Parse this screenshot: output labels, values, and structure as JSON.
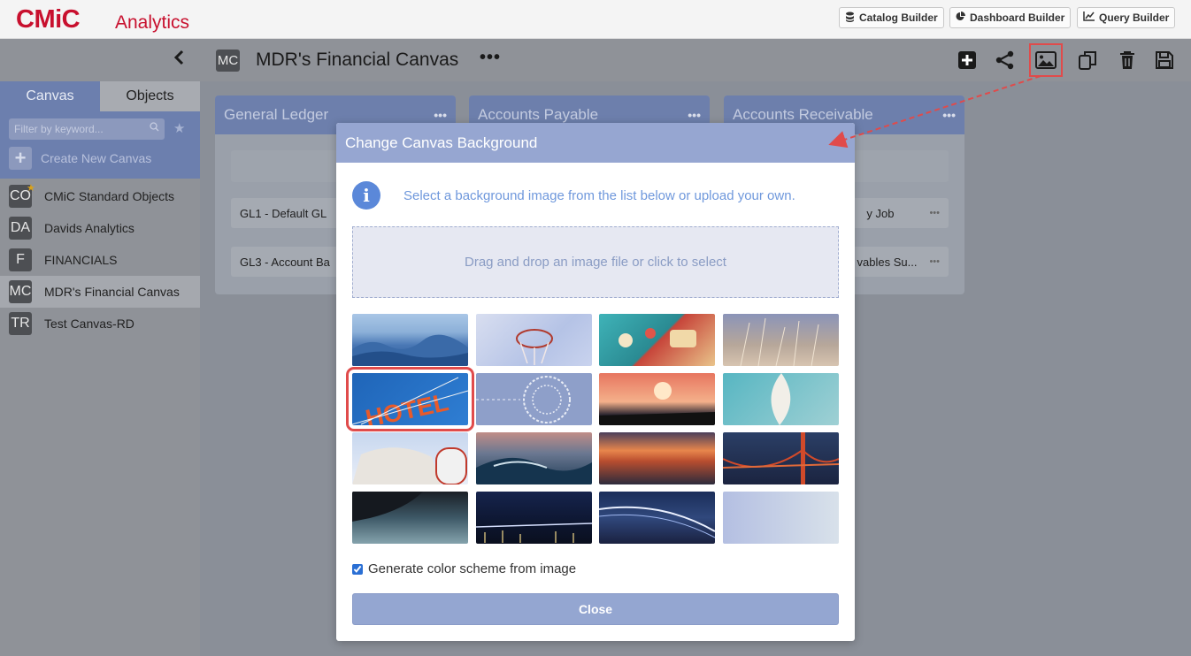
{
  "app": {
    "logo": "CMiC",
    "product": "Analytics"
  },
  "header": {
    "buttons": [
      {
        "label": "Catalog Builder",
        "icon": "database-icon"
      },
      {
        "label": "Dashboard Builder",
        "icon": "pie-chart-icon"
      },
      {
        "label": "Query Builder",
        "icon": "line-chart-icon"
      }
    ]
  },
  "sidebar": {
    "tabs": [
      {
        "label": "Canvas",
        "active": true
      },
      {
        "label": "Objects",
        "active": false
      }
    ],
    "filter_placeholder": "Filter by keyword...",
    "create_label": "Create New Canvas",
    "canvases": [
      {
        "badge": "CO",
        "name": "CMiC Standard Objects",
        "starred": true
      },
      {
        "badge": "DA",
        "name": "Davids Analytics",
        "starred": false
      },
      {
        "badge": "F",
        "name": "FINANCIALS",
        "starred": false
      },
      {
        "badge": "MC",
        "name": "MDR's Financial Canvas",
        "starred": false,
        "selected": true
      },
      {
        "badge": "TR",
        "name": "Test Canvas-RD",
        "starred": false
      }
    ]
  },
  "canvas": {
    "badge": "MC",
    "title": "MDR's Financial Canvas",
    "menu": "•••",
    "tools": [
      "add-icon",
      "share-icon",
      "image-icon",
      "copy-icon",
      "trash-icon",
      "save-icon"
    ],
    "panels": [
      {
        "title": "General Ledger",
        "rows": [
          "GL1 - Default GL",
          "GL3 - Account Ba"
        ]
      },
      {
        "title": "Accounts Payable",
        "rows": []
      },
      {
        "title": "Accounts Receivable",
        "rows": [
          "y Job",
          "vables Su..."
        ]
      }
    ]
  },
  "modal": {
    "title": "Change Canvas Background",
    "info": "Select a background image from the list below or upload your own.",
    "dropzone": "Drag and drop an image file or click to select",
    "checkbox_label": "Generate color scheme from image",
    "checkbox_checked": true,
    "close_label": "Close",
    "thumbnails": [
      {
        "name": "misty-mountains",
        "selected": false
      },
      {
        "name": "basketball-hoop",
        "selected": false
      },
      {
        "name": "arcade-controls",
        "selected": false
      },
      {
        "name": "dry-grass",
        "selected": false
      },
      {
        "name": "hotel-sign",
        "selected": true
      },
      {
        "name": "word-sphere",
        "selected": false
      },
      {
        "name": "sunset-skyline",
        "selected": false
      },
      {
        "name": "white-feather",
        "selected": false
      },
      {
        "name": "rooftop-dome",
        "selected": false
      },
      {
        "name": "ocean-wave",
        "selected": false
      },
      {
        "name": "sunset-sea",
        "selected": false
      },
      {
        "name": "golden-gate-bridge",
        "selected": false
      },
      {
        "name": "lake-cliff",
        "selected": false
      },
      {
        "name": "night-bridge-city",
        "selected": false
      },
      {
        "name": "lit-bridge-night",
        "selected": false
      },
      {
        "name": "pastel-gradient",
        "selected": false
      }
    ]
  }
}
